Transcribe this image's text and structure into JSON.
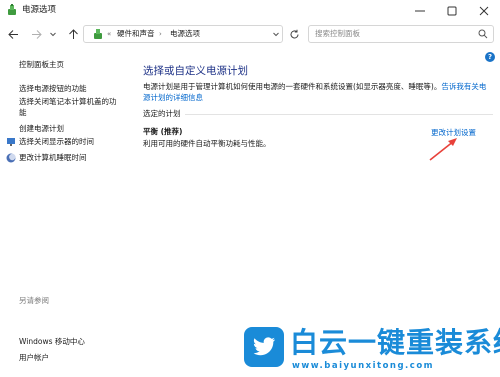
{
  "window": {
    "title": "电源选项"
  },
  "address_bar": {
    "separator": "«",
    "breadcrumbs": [
      {
        "label": "硬件和声音"
      },
      {
        "label": "电源选项"
      }
    ],
    "arrow": "›"
  },
  "search": {
    "placeholder": "搜索控制面板"
  },
  "help": {
    "label": "?"
  },
  "sidebar": {
    "home_link": "控制面板主页",
    "items": [
      {
        "label": "选择电源按钮的功能"
      },
      {
        "label": "选择关闭笔记本计算机盖的功"
      },
      {
        "label": "能"
      },
      {
        "label": "创建电源计划"
      },
      {
        "label": "选择关闭显示器的时间"
      },
      {
        "label": "更改计算机睡眠时间"
      }
    ],
    "see_also_heading": "另请参阅",
    "see_also": [
      {
        "label": "Windows 移动中心"
      },
      {
        "label": "用户帐户"
      }
    ]
  },
  "main": {
    "title": "选择或自定义电源计划",
    "description": "电源计划是用于管理计算机如何使用电源的一套硬件和系统设置(如显示器亮度、睡眠等)。",
    "description_link": "告诉我有关电源计划的详细信息",
    "section_label": "选定的计划",
    "plan_name": "平衡 (推荐)",
    "plan_description": "利用可用的硬件自动平衡功耗与性能。",
    "plan_settings_link": "更改计划设置"
  },
  "watermark": {
    "title": "白云一键重装系统",
    "url": "www.baiyunxitong.com"
  },
  "colors": {
    "accent_title": "#1e3287",
    "link": "#0066cc",
    "watermark": "#1a8bd8",
    "arrow": "#e8413a"
  }
}
